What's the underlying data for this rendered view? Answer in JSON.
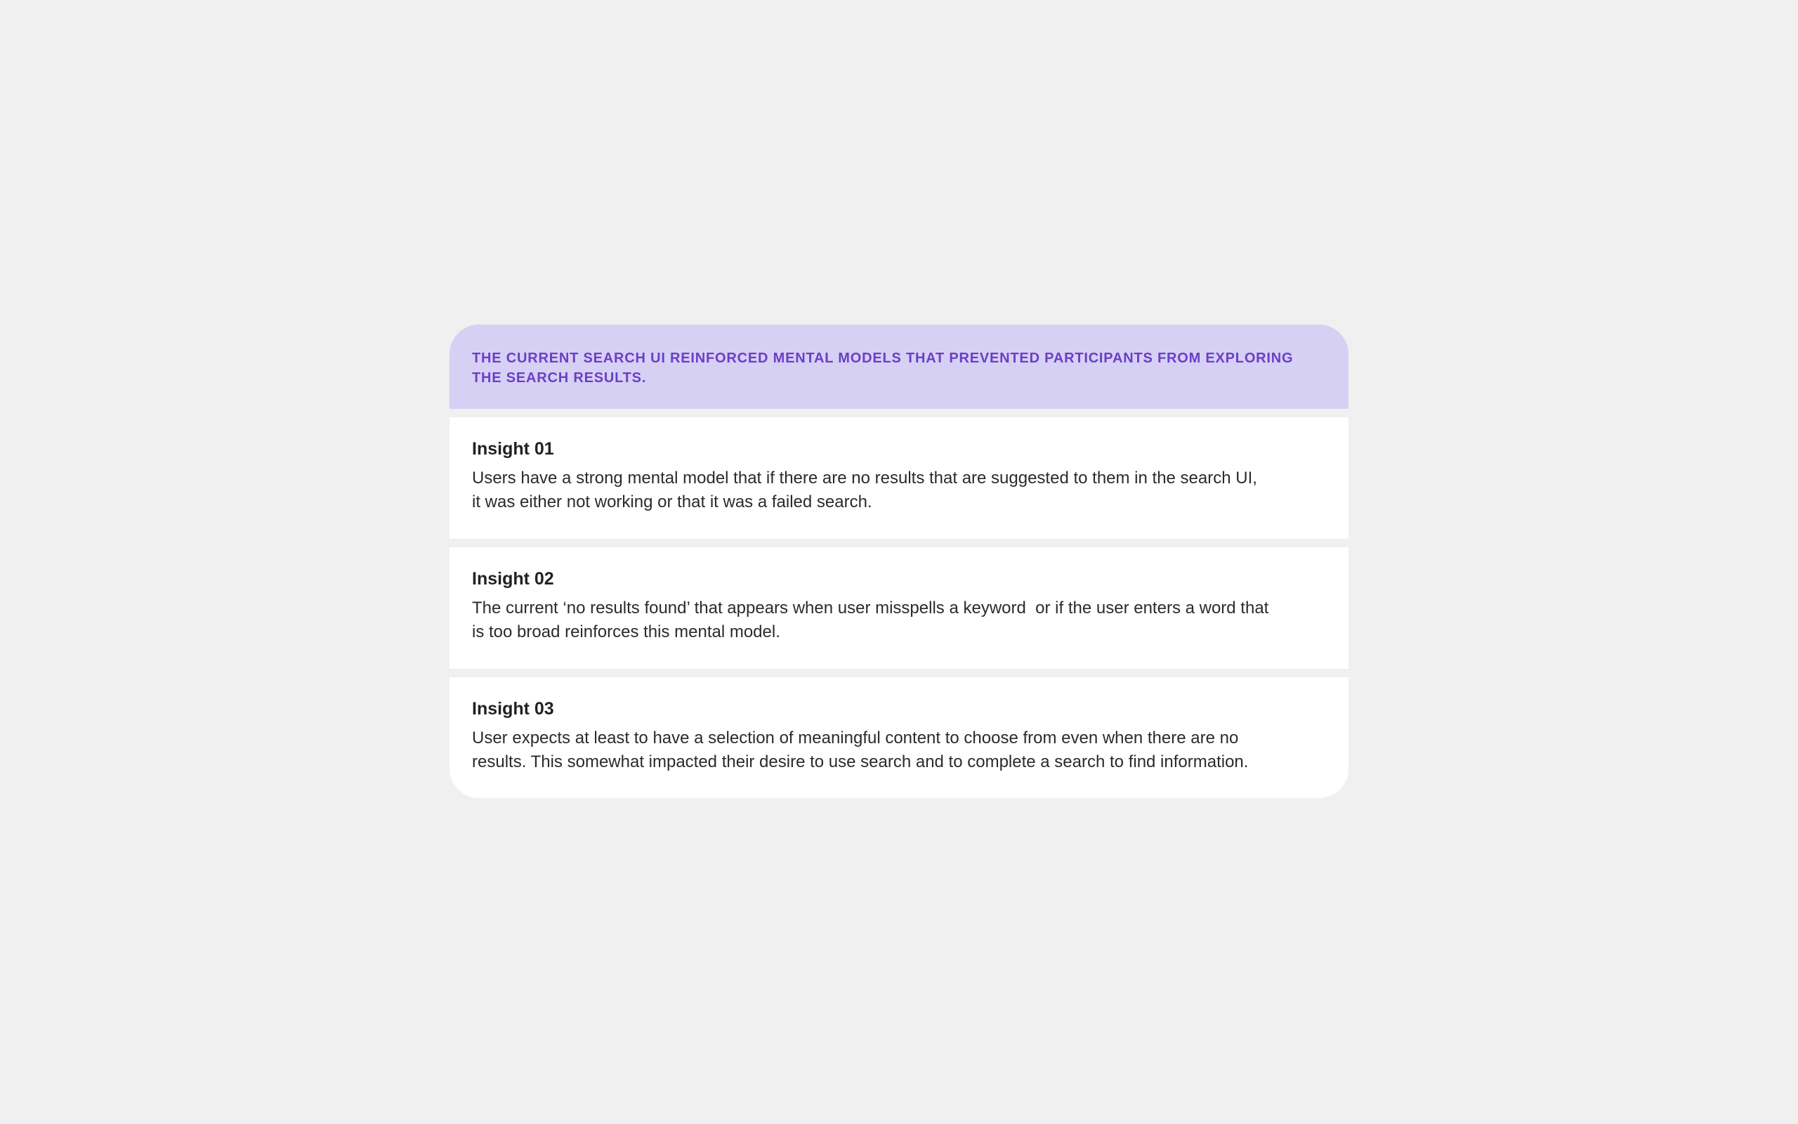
{
  "panel": {
    "heading": "THE CURRENT SEARCH UI REINFORCED MENTAL MODELS THAT PREVENTED PARTICIPANTS FROM EXPLORING THE SEARCH RESULTS."
  },
  "insights": [
    {
      "title": "Insight 01",
      "body": "Users have a strong mental model that if there are no results that are suggested to them in the search UI,\nit was either not working or that it was a failed search."
    },
    {
      "title": "Insight 02",
      "body": "The current ‘no results found’ that appears when user misspells a keyword  or if the user enters a word that\nis too broad reinforces this mental model."
    },
    {
      "title": "Insight 03",
      "body": "User expects at least to have a selection of meaningful content to choose from even when there are no\nresults. This somewhat impacted their desire to use search and to complete a search to find information."
    }
  ],
  "colors": {
    "page_background": "#f0f0f0",
    "header_background": "#d6d0f4",
    "header_text": "#6a3fc7",
    "card_background": "#ffffff"
  }
}
